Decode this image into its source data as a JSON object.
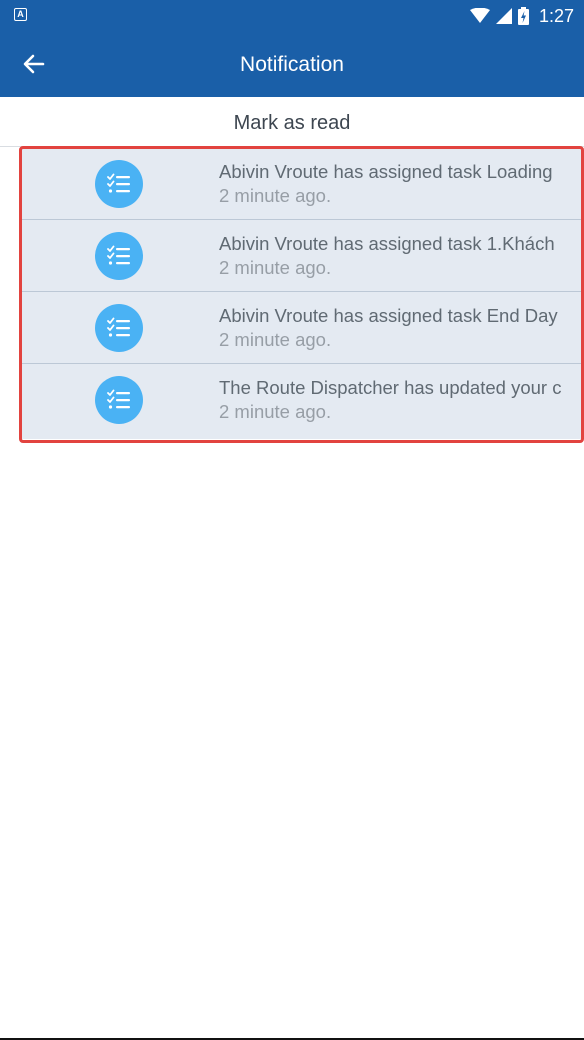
{
  "status_bar": {
    "time": "1:27",
    "icons": [
      "app-notification-icon",
      "wifi-icon",
      "signal-icon",
      "battery-charging-icon"
    ]
  },
  "app_bar": {
    "title": "Notification",
    "back_icon": "arrow-left-icon"
  },
  "mark_as_read": "Mark as read",
  "notifications": [
    {
      "title": "Abivin Vroute has assigned task Loading",
      "time": "2 minute ago.",
      "icon": "task-list-icon"
    },
    {
      "title": "Abivin Vroute has assigned task 1.Khách",
      "time": "2 minute ago.",
      "icon": "task-list-icon"
    },
    {
      "title": "Abivin Vroute has assigned task End Day",
      "time": "2 minute ago.",
      "icon": "task-list-icon"
    },
    {
      "title": "The Route Dispatcher has updated your c",
      "time": "2 minute ago.",
      "icon": "task-list-icon"
    }
  ],
  "colors": {
    "primary": "#1a5fa8",
    "item_background": "#e4eaf2",
    "icon_background": "#4ab2f4",
    "highlight": "#e2433f"
  }
}
